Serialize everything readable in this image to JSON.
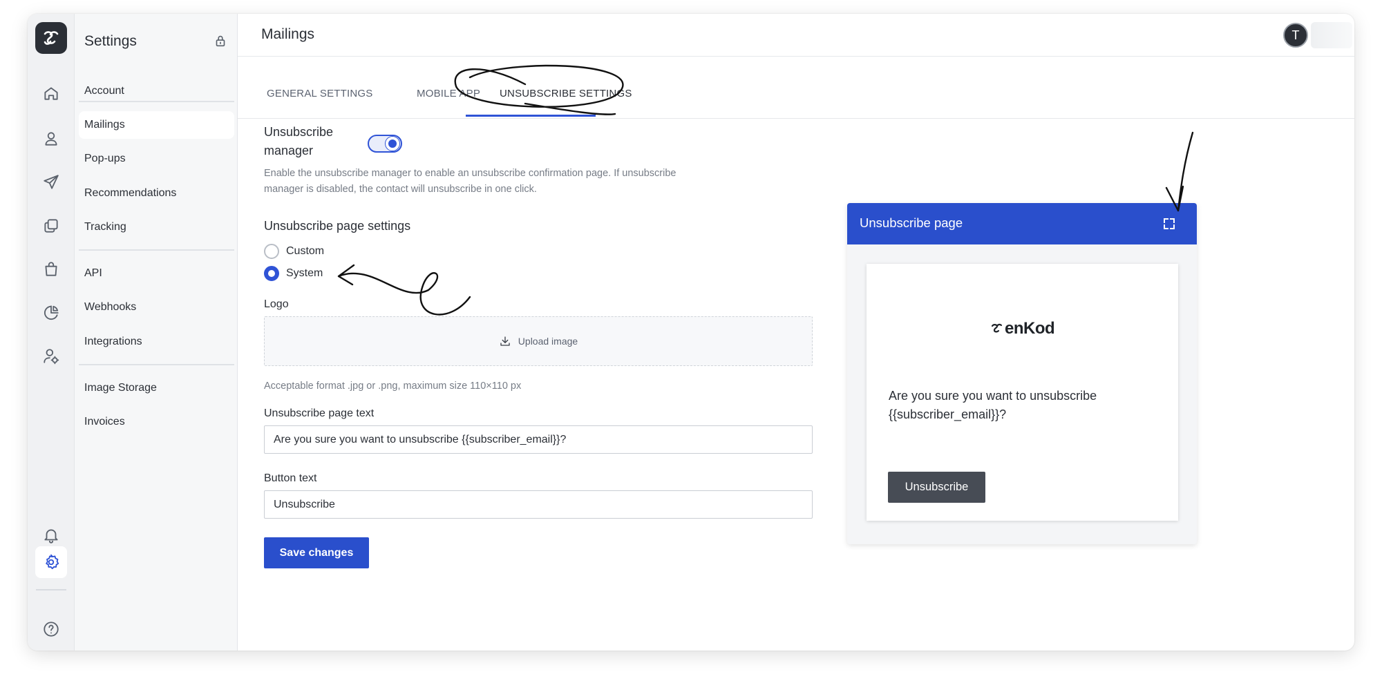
{
  "header": {
    "page_title": "Mailings",
    "avatar_initial": "T"
  },
  "sidebar": {
    "title": "Settings",
    "groups": [
      {
        "items": [
          {
            "label": "Account"
          }
        ]
      },
      {
        "items": [
          {
            "label": "Mailings"
          },
          {
            "label": "Pop-ups"
          },
          {
            "label": "Recommendations"
          },
          {
            "label": "Tracking"
          }
        ]
      },
      {
        "items": [
          {
            "label": "API"
          },
          {
            "label": "Webhooks"
          },
          {
            "label": "Integrations"
          }
        ]
      },
      {
        "items": [
          {
            "label": "Image Storage"
          },
          {
            "label": "Invoices"
          }
        ]
      }
    ],
    "active_item": "Mailings"
  },
  "rail": {
    "icons": [
      "home-icon",
      "contacts-icon",
      "send-icon",
      "templates-icon",
      "shop-bag-icon",
      "analytics-pie-icon",
      "user-settings-icon"
    ],
    "bottom_icons": [
      "bell-icon",
      "gear-icon",
      "help-icon"
    ],
    "active_icon": "gear-icon"
  },
  "tabs": [
    {
      "label": "GENERAL SETTINGS",
      "active": false
    },
    {
      "label": "MOBILE APP",
      "active": false
    },
    {
      "label": "UNSUBSCRIBE SETTINGS",
      "active": true
    }
  ],
  "form": {
    "manager_label_line1": "Unsubscribe",
    "manager_label_line2": "manager",
    "manager_enabled": true,
    "manager_help_line1": "Enable the unsubscribe manager to enable an unsubscribe confirmation page. If unsubscribe",
    "manager_help_line2": "manager is disabled, the contact will unsubscribe in one click.",
    "page_settings_label": "Unsubscribe page settings",
    "options": [
      {
        "label": "Custom",
        "checked": false
      },
      {
        "label": "System",
        "checked": true
      }
    ],
    "logo_label": "Logo",
    "upload_label": "Upload image",
    "upload_hint": "Acceptable format .jpg or .png, maximum size 110×110 px",
    "page_text_label": "Unsubscribe page text",
    "page_text_value": "Are you sure you want to unsubscribe {{subscriber_email}}?",
    "button_text_label": "Button text",
    "button_text_value": "Unsubscribe",
    "save_label": "Save changes"
  },
  "preview": {
    "title": "Unsubscribe page",
    "brand": "enKod",
    "text_line1": "Are you sure you want to unsubscribe",
    "text_line2": "{{subscriber_email}}?",
    "button_label": "Unsubscribe"
  },
  "colors": {
    "accent": "#2f53d6",
    "primary_button": "#2a4fcc",
    "preview_button": "#474c55",
    "rail_bg": "#f0f1f3",
    "sidebar_bg": "#f6f7f8"
  }
}
